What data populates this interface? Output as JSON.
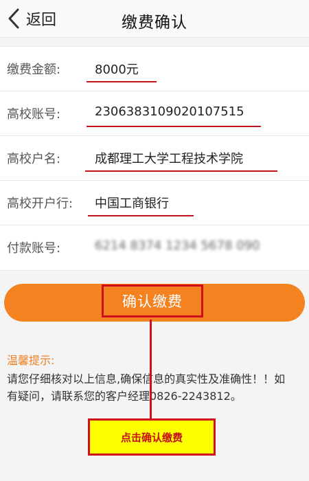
{
  "header": {
    "back_label": "返回",
    "title": "缴费确认"
  },
  "form": {
    "rows": [
      {
        "label": "缴费金额:",
        "value": "8000元"
      },
      {
        "label": "高校账号:",
        "value": "2306383109020107515"
      },
      {
        "label": "高校户名:",
        "value": "成都理工大学工程技术学院"
      },
      {
        "label": "高校开户行:",
        "value": "中国工商银行"
      },
      {
        "label": "付款账号:",
        "value": "6214 8374 1234 5678 090"
      }
    ]
  },
  "confirm_button": {
    "label": "确认缴费"
  },
  "tips": {
    "title": "温馨提示:",
    "text": "请您仔细核对以上信息,确保信息的真实性及准确性！！如有疑问，请联系您的客户经理0826-2243812。"
  },
  "annotation": {
    "callout_text": "点击确认缴费"
  },
  "colors": {
    "accent": "#f58220",
    "highlight_red": "#d10f1a",
    "callout_yellow": "#ffff00",
    "tip_title": "#f07f22"
  },
  "icons": {
    "back": "chevron-left-icon"
  }
}
